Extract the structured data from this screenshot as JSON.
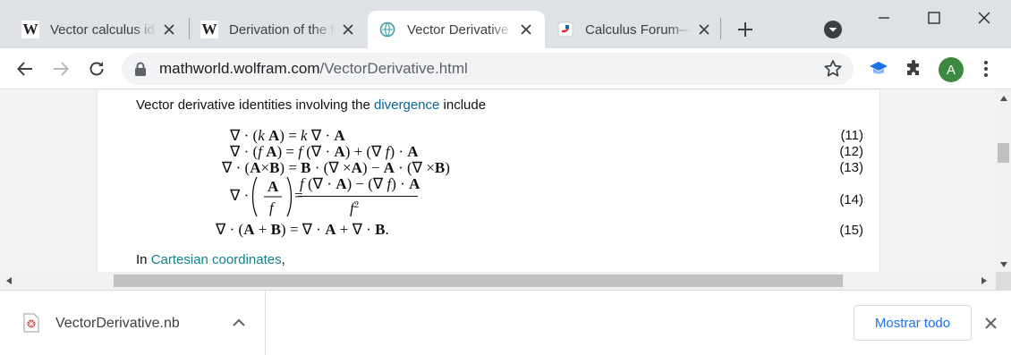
{
  "tabs": [
    {
      "title": "Vector calculus identities",
      "favicon": "wikipedia-icon"
    },
    {
      "title": "Derivation of the formula",
      "favicon": "wikipedia-icon"
    },
    {
      "title": "Vector Derivative",
      "favicon": "wolfram-icon",
      "active": true
    },
    {
      "title": "Calculus Forum—",
      "favicon": "forum-icon"
    }
  ],
  "wikipedia_glyph": "W",
  "address_bar": {
    "domain": "mathworld.wolfram.com",
    "path": "/VectorDerivative.html"
  },
  "profile": {
    "initial": "A",
    "color": "#3c8a3f"
  },
  "page": {
    "intro_before": "Vector derivative identities involving the ",
    "intro_link": "divergence",
    "intro_after": " include",
    "outro_prefix": "In ",
    "outro_link": "Cartesian coordinates",
    "outro_suffix": ","
  },
  "equations": [
    {
      "number": "(11)",
      "text": "∇·(k A) = k ∇·A"
    },
    {
      "number": "(12)",
      "text": "∇·(f A) = f (∇·A) + (∇f)·A"
    },
    {
      "number": "(13)",
      "text": "∇·(A×B) = B·(∇×A) − A·(∇×B)"
    },
    {
      "number": "(14)",
      "text": "∇·(A/f) = (f (∇·A) − (∇f)·A)/f²"
    },
    {
      "number": "(15)",
      "text": "∇·(A + B) = ∇·A + ∇·B."
    }
  ],
  "download": {
    "filename": "VectorDerivative.nb",
    "show_all_label": "Mostrar todo"
  },
  "colors": {
    "tabstrip": "#dee1e6",
    "link": "#0c6596",
    "link_teal": "#11818a",
    "accent_blue": "#1a73e8"
  }
}
